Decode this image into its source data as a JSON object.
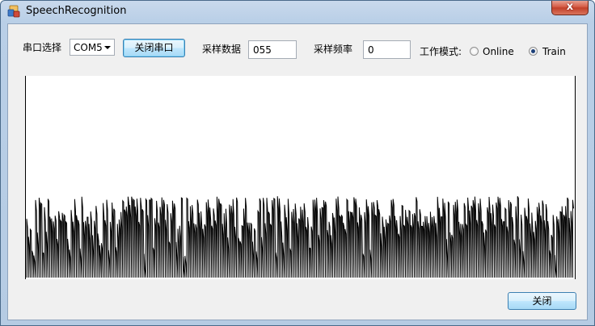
{
  "window": {
    "title": "SpeechRecognition",
    "close_glyph": "x"
  },
  "toolbar": {
    "port_label": "串口选择",
    "port_selected": "COM5",
    "close_port_button": "关闭串口",
    "sample_data_label": "采样数据",
    "sample_data_value": "055",
    "sample_freq_label": "采样频率",
    "sample_freq_value": "0",
    "mode_label": "工作模式:",
    "mode_options": [
      {
        "label": "Online",
        "selected": false
      },
      {
        "label": "Train",
        "selected": true
      }
    ]
  },
  "footer": {
    "close_button": "关闭"
  },
  "waveform": {
    "baseline": 0,
    "max_level": 1,
    "typical_level_range": [
      0.25,
      0.38
    ],
    "peak_level_range": [
      0.38,
      0.4
    ],
    "line_color": "#000000",
    "background_color": "#ffffff"
  }
}
